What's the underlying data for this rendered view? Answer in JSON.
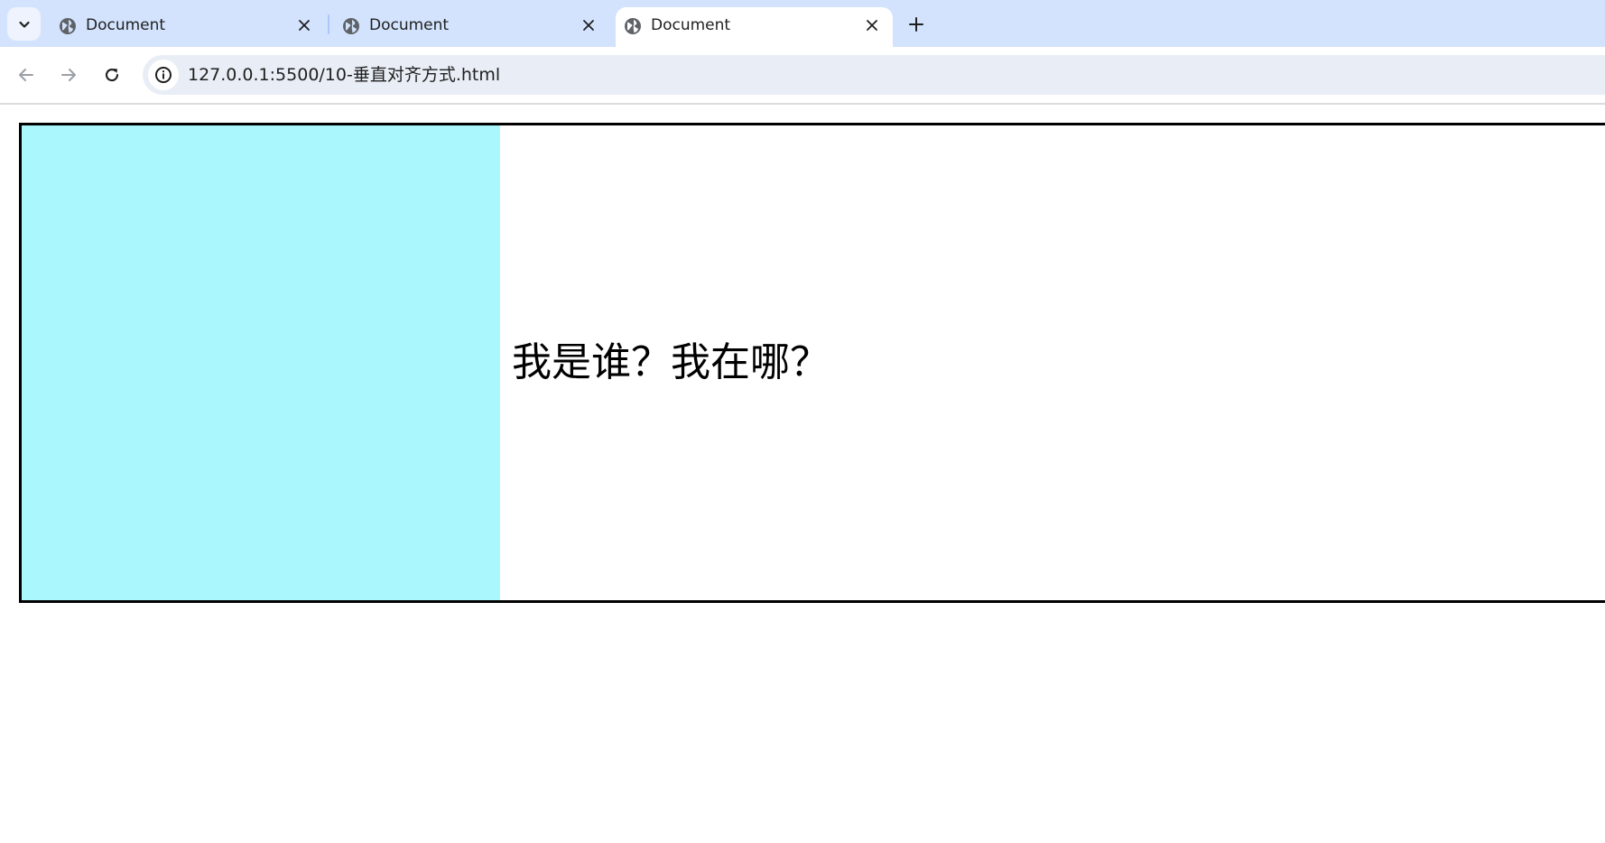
{
  "browser": {
    "tabs": [
      {
        "title": "Document",
        "active": false
      },
      {
        "title": "Document",
        "active": false
      },
      {
        "title": "Document",
        "active": true
      }
    ],
    "address_bar": {
      "url": "127.0.0.1:5500/10-垂直对齐方式.html"
    }
  },
  "page": {
    "caption": "我是谁？我在哪？",
    "colors": {
      "block_background": "#aaf7fd",
      "border": "#000000",
      "tabstrip": "#d3e3fd"
    }
  },
  "icons": [
    "tab-search-icon",
    "globe-icon",
    "close-icon",
    "plus-icon",
    "back-arrow-icon",
    "forward-arrow-icon",
    "reload-icon",
    "site-info-icon"
  ]
}
